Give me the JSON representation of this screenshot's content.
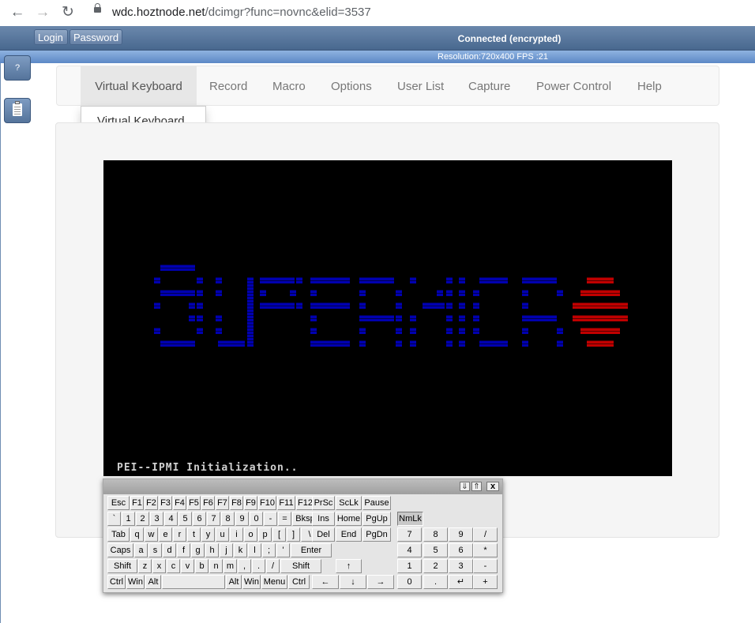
{
  "browser": {
    "url_host": "wdc.hoztnode.net",
    "url_path": "/dcimgr?func=novnc&elid=3537"
  },
  "topbar": {
    "login_label": "Login",
    "password_label": "Password",
    "status": "Connected (encrypted)",
    "resolution": "Resolution:720x400 FPS :21"
  },
  "sidebar": {
    "help_label": "?"
  },
  "menu": {
    "items": [
      "Virtual Keyboard",
      "Record",
      "Macro",
      "Options",
      "User List",
      "Capture",
      "Power Control",
      "Help"
    ],
    "active_index": 0,
    "dropdown": [
      "Virtual Keyboard"
    ]
  },
  "screen": {
    "bios_text": "PEI--IPMI Initialization..",
    "colors": {
      "background": "#000000",
      "text": "#d0d0d0",
      "logo_blue": "#0000b0",
      "logo_red": "#c00000"
    }
  },
  "keyboard": {
    "window_controls": [
      "⇓",
      "⇑",
      "x"
    ],
    "main_rows": [
      [
        "Esc",
        "F1",
        "F2",
        "F3",
        "F4",
        "F5",
        "F6",
        "F7",
        "F8",
        "F9",
        "F10",
        "F11",
        "F12"
      ],
      [
        "`",
        "1",
        "2",
        "3",
        "4",
        "5",
        "6",
        "7",
        "8",
        "9",
        "0",
        "-",
        "=",
        "Bksp"
      ],
      [
        "Tab",
        "q",
        "w",
        "e",
        "r",
        "t",
        "y",
        "u",
        "i",
        "o",
        "p",
        "[",
        "]",
        "\\"
      ],
      [
        "Caps",
        "a",
        "s",
        "d",
        "f",
        "g",
        "h",
        "j",
        "k",
        "l",
        ";",
        "'",
        "Enter"
      ],
      [
        "Shift",
        "z",
        "x",
        "c",
        "v",
        "b",
        "n",
        "m",
        ",",
        ".",
        "/",
        "Shift"
      ],
      [
        "Ctrl",
        "Win",
        "Alt",
        " ",
        "Alt",
        "Win",
        "Menu",
        "Ctrl"
      ]
    ],
    "nav_keys": {
      "row1": [
        "PrSc",
        "ScLk",
        "Pause"
      ],
      "row2": [
        "Ins",
        "Home",
        "PgUp"
      ],
      "row3": [
        "Del",
        "End",
        "PgDn"
      ],
      "up": "↑",
      "arrows": [
        "←",
        "↓",
        "→"
      ]
    },
    "numpad": {
      "numlock": "NmLk",
      "rows": [
        [
          "7",
          "8",
          "9",
          "/"
        ],
        [
          "4",
          "5",
          "6",
          "*"
        ],
        [
          "1",
          "2",
          "3",
          "-"
        ],
        [
          "0",
          ".",
          "↵",
          "+"
        ]
      ]
    }
  }
}
